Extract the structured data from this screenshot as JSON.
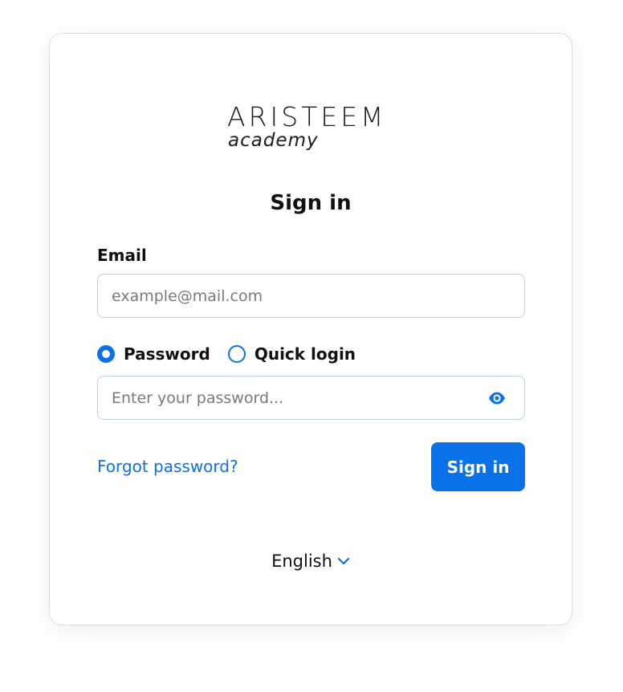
{
  "brand": {
    "wordmark": "ARISTEEM",
    "subtitle": "academy"
  },
  "form": {
    "title": "Sign in",
    "email": {
      "label": "Email",
      "placeholder": "example@mail.com",
      "value": ""
    },
    "auth_modes": [
      {
        "label": "Password",
        "selected": true
      },
      {
        "label": "Quick login",
        "selected": false
      }
    ],
    "password": {
      "placeholder": "Enter your password...",
      "value": "",
      "toggle_icon": "eye-icon"
    },
    "forgot_link": "Forgot password?",
    "submit_label": "Sign in"
  },
  "language": {
    "selected": "English",
    "icon": "chevron-down-icon"
  },
  "colors": {
    "accent": "#0a72e8",
    "input_border": "#b9d3ee",
    "card_border": "#dedede"
  }
}
